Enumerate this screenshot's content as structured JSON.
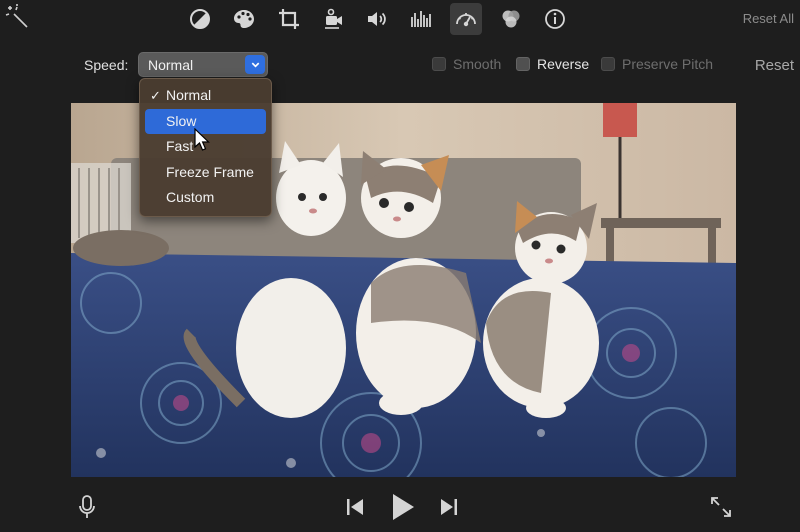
{
  "toolbar": {
    "reset_all_label": "Reset All",
    "icons": [
      "magic-wand-icon",
      "color-balance-icon",
      "color-correction-icon",
      "crop-icon",
      "stabilization-icon",
      "volume-icon",
      "noise-reduction-icon",
      "speed-icon",
      "video-overlay-icon",
      "info-icon"
    ],
    "active_tool": "speed-icon"
  },
  "speed": {
    "label": "Speed:",
    "selected": "Normal",
    "options": [
      "Normal",
      "Slow",
      "Fast",
      "Freeze Frame",
      "Custom"
    ],
    "checked_option": "Normal",
    "highlighted_option": "Slow",
    "check_mark": "✓"
  },
  "options": {
    "smooth": "Smooth",
    "reverse": "Reverse",
    "preserve_pitch": "Preserve Pitch"
  },
  "reset_label": "Reset",
  "colors": {
    "background": "#1e1e1e",
    "accent": "#2e6ad8",
    "menu_bg": "#4a3c30"
  },
  "bottom_controls": [
    "microphone-icon",
    "skip-back-icon",
    "play-icon",
    "skip-forward-icon",
    "fullscreen-icon"
  ]
}
